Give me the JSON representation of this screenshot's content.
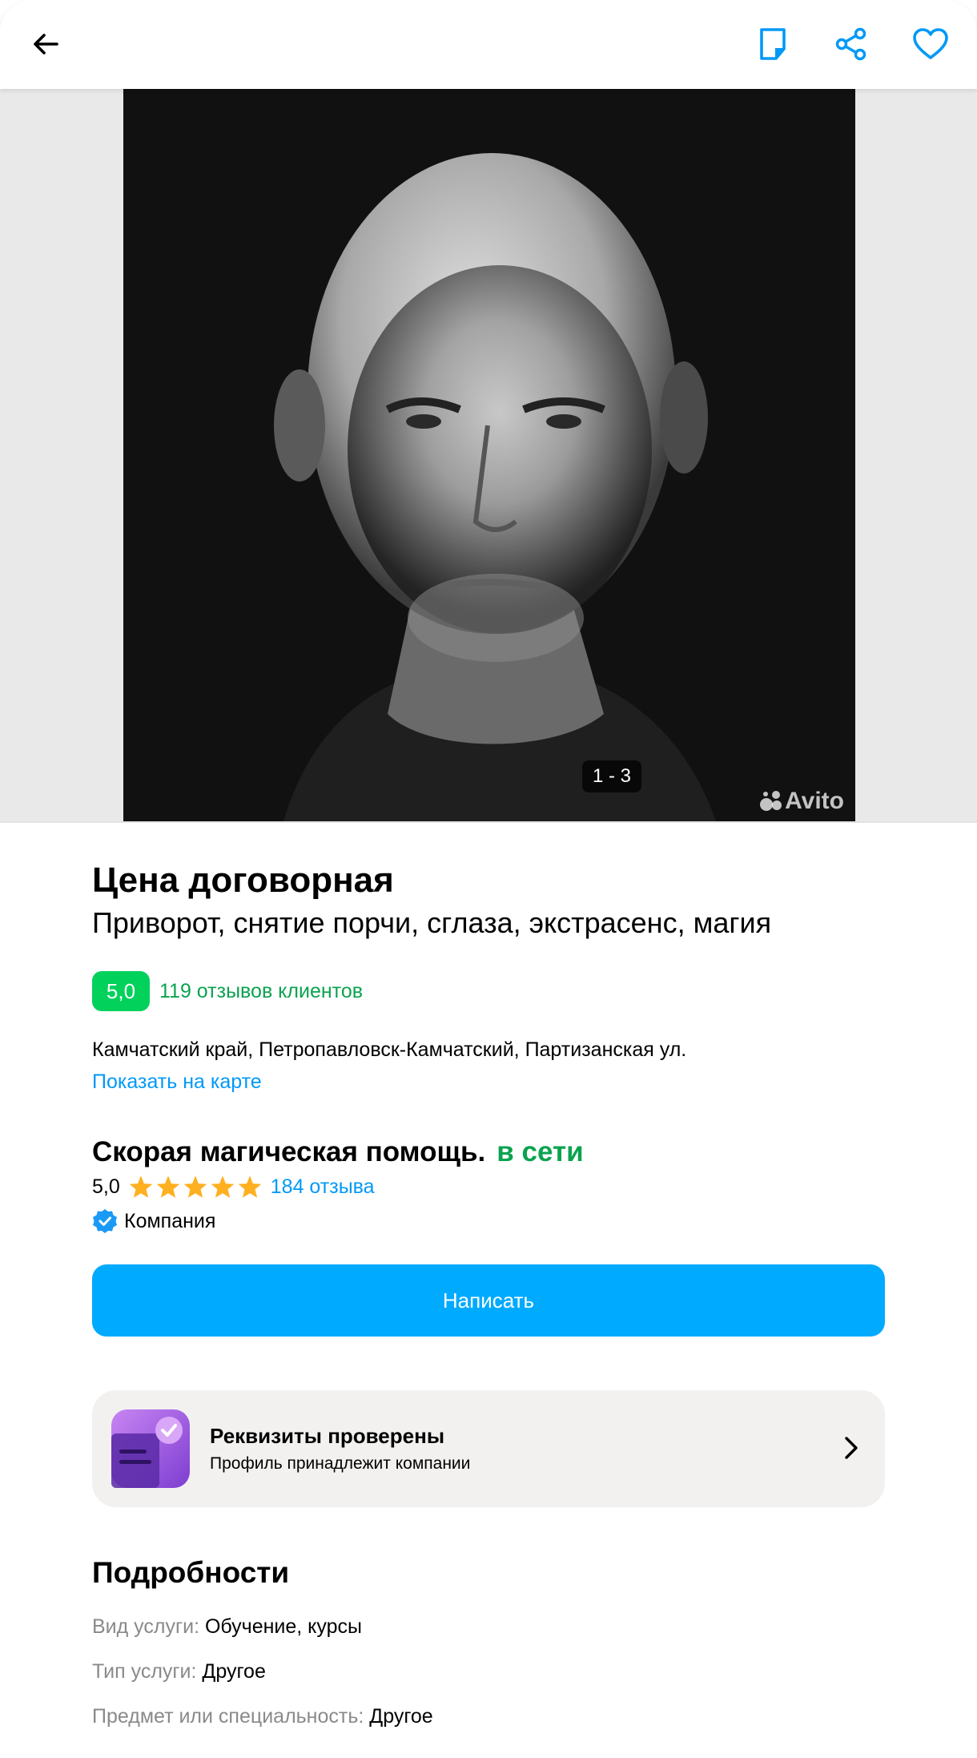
{
  "header": {
    "back_icon": "arrow-left-icon",
    "note_icon": "note-icon",
    "share_icon": "share-icon",
    "favorite_icon": "heart-icon",
    "accent": "#0099f7"
  },
  "gallery": {
    "counter": "1 - 3",
    "watermark": "Avito"
  },
  "listing": {
    "price": "Цена договорная",
    "title": "Приворот, снятие порчи, сглаза, экстрасенс, магия",
    "rating_value": "5,0",
    "rating_reviews": "119 отзывов клиентов",
    "address": "Камчатский край, Петропавловск-Камчатский, Партизанская ул.",
    "map_link": "Показать на карте"
  },
  "seller": {
    "name": "Скорая магическая помощь.",
    "status": "в сети",
    "rating": "5,0",
    "stars": 5,
    "reviews": "184 отзыва",
    "type": "Компания"
  },
  "actions": {
    "write": "Написать"
  },
  "verified": {
    "title": "Реквизиты проверены",
    "subtitle": "Профиль принадлежит компании"
  },
  "details": {
    "heading": "Подробности",
    "items": [
      {
        "key": "Вид услуги:",
        "value": "Обучение, курсы"
      },
      {
        "key": "Тип услуги:",
        "value": "Другое"
      },
      {
        "key": "Предмет или специальность:",
        "value": "Другое"
      }
    ]
  }
}
